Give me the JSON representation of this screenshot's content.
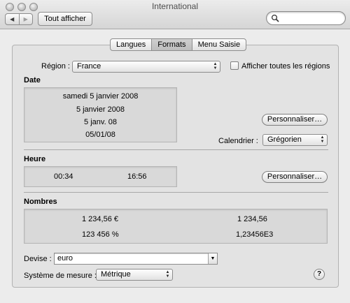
{
  "window": {
    "title": "International"
  },
  "toolbar": {
    "back_label": "◀",
    "forward_label": "▶",
    "show_all_label": "Tout afficher",
    "search_placeholder": ""
  },
  "tabs": [
    {
      "label": "Langues",
      "active": false
    },
    {
      "label": "Formats",
      "active": true
    },
    {
      "label": "Menu Saisie",
      "active": false
    }
  ],
  "region": {
    "label": "Région :",
    "value": "France",
    "show_all_label": "Afficher toutes les régions",
    "show_all_checked": false
  },
  "date": {
    "heading": "Date",
    "examples": [
      "samedi 5 janvier 2008",
      "5 janvier 2008",
      "5 janv. 08",
      "05/01/08"
    ],
    "customize_label": "Personnaliser…",
    "calendar_label": "Calendrier :",
    "calendar_value": "Grégorien"
  },
  "time": {
    "heading": "Heure",
    "examples": [
      "00:34",
      "16:56"
    ],
    "customize_label": "Personnaliser…"
  },
  "numbers": {
    "heading": "Nombres",
    "examples": [
      "1 234,56 €",
      "1 234,56",
      "123 456 %",
      "1,23456E3"
    ]
  },
  "currency": {
    "label": "Devise :",
    "value": "euro"
  },
  "measurement": {
    "label": "Système de mesure :",
    "value": "Métrique"
  },
  "help_label": "?"
}
